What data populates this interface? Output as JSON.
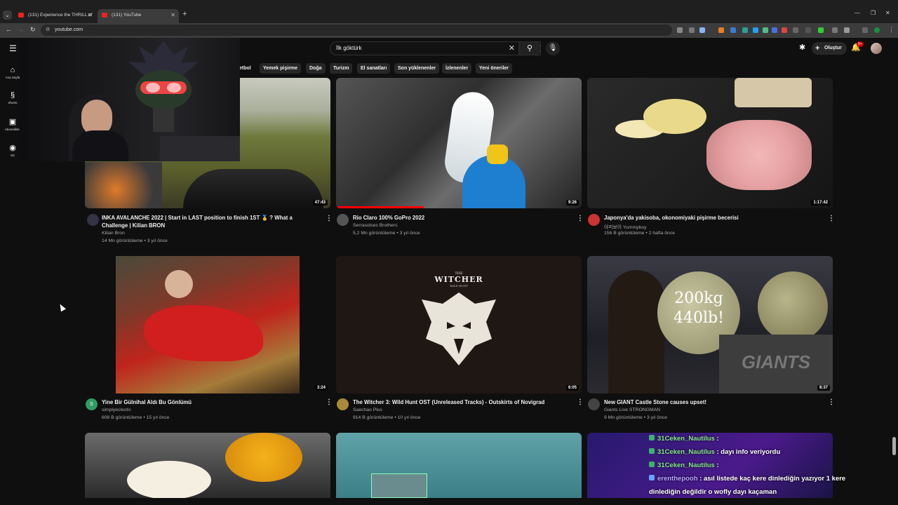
{
  "browser": {
    "tabs": [
      {
        "title": "(131) Experience the THRILL of"
      },
      {
        "title": "(131) YouTube"
      }
    ],
    "address": "youtube.com"
  },
  "masthead": {
    "search_value": "İlk göktürk",
    "create_label": "Oluştur",
    "notification_count": "9+"
  },
  "sidebar": {
    "items": [
      {
        "label": "Ana Sayfa",
        "icon": "home-icon"
      },
      {
        "label": "Shorts",
        "icon": "shorts-icon"
      },
      {
        "label": "Abonelikler",
        "icon": "subscriptions-icon"
      },
      {
        "label": "Siz",
        "icon": "you-icon"
      }
    ]
  },
  "chips": [
    "Futbol",
    "Yemek pişirme",
    "Doğa",
    "Turizm",
    "El sanatları",
    "Son yüklenenler",
    "İzlenenler",
    "Yeni öneriler"
  ],
  "chips_visible": [
    "etbol",
    "Yemek pişirme",
    "Doğa",
    "Turizm",
    "El sanatları",
    "Son yüklenenler",
    "İzlenenler",
    "Yeni öneriler"
  ],
  "videos": [
    {
      "title": "INKA AVALANCHE 2022 | Start in LAST position to finish 1ST 🥇 ? What a Challenge | Kilian BRON",
      "channel": "Kilian Bron",
      "meta": "14 Mn görüntüleme • 3 yıl önce",
      "duration": "47:43"
    },
    {
      "title": "Rio Claro 100% GoPro 2022",
      "channel": "Serrasolses Brothers",
      "meta": "5,2 Mn görüntüleme • 3 yıl önce",
      "duration": "9:26"
    },
    {
      "title": "Japonya'da yakisoba, okonomiyaki pişirme becerisi",
      "channel": "야미보이 Yummyboy",
      "meta": "156 B görüntüleme • 2 hafta önce",
      "duration": "1:17:42"
    },
    {
      "title": "Yine Bir Gülnihal Aldı Bu Gönlümü",
      "channel": "simplyeclectic",
      "meta": "608 B görüntüleme • 15 yıl önce",
      "duration": "3:24",
      "avatar_letter": "S"
    },
    {
      "title": "The Witcher 3: Wild Hunt OST (Unreleased Tracks) - Outskirts of Novigrad",
      "channel": "Saechao Plus",
      "meta": "914 B görüntüleme • 10 yıl önce",
      "duration": "6:05"
    },
    {
      "title": "New GIANT Castle Stone causes upset!",
      "channel": "Giants Live STRONGMAN",
      "meta": "9 Mn görüntüleme • 3 yıl önce",
      "duration": "8:37"
    }
  ],
  "thumb_text": {
    "witcher_top": "THE",
    "witcher_main": "WITCHER",
    "witcher_sub": "WILD HUNT",
    "stone_line1": "200kg",
    "stone_line2": "440lb!",
    "giants": "GIANTS"
  },
  "chat": [
    {
      "user": "31Ceken_Nautilus",
      "text": " : "
    },
    {
      "user": "31Ceken_Nautilus",
      "text": " : dayı info veriyordu"
    },
    {
      "user": "31Ceken_Nautilus",
      "text": " : "
    },
    {
      "user": "erenthepooh",
      "text": " : asıl listede kaç kere dinlediğin yazıyor 1 kere"
    },
    {
      "user": "",
      "text": "dinlediğin değildir o wofly dayı kaçaman"
    }
  ]
}
